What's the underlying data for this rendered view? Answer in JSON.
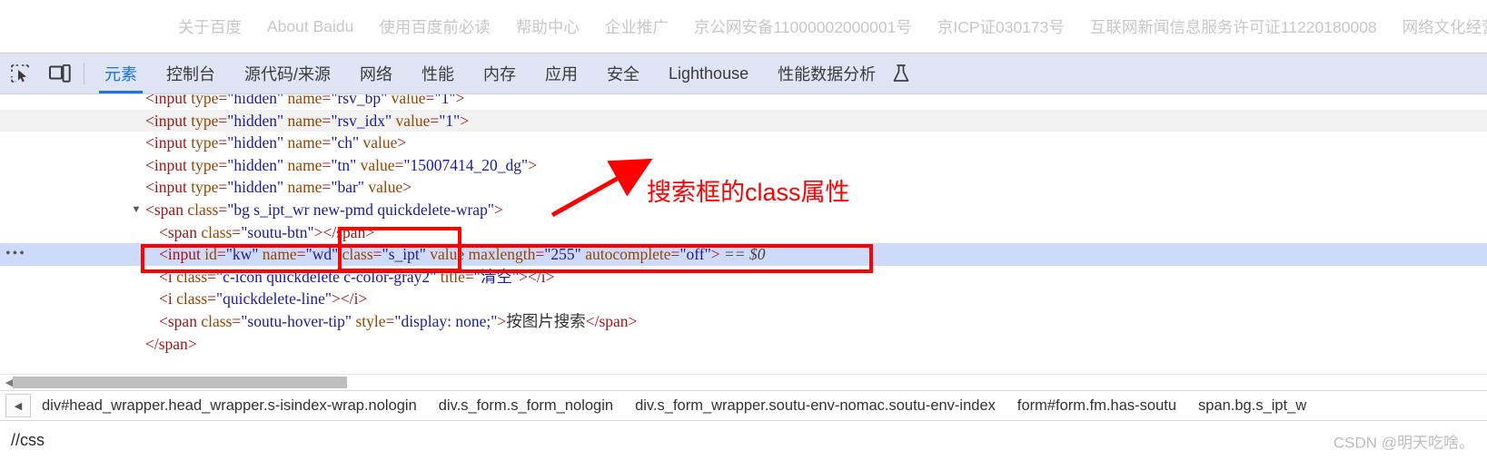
{
  "page_footer": {
    "links": [
      "关于百度",
      "About Baidu",
      "使用百度前必读",
      "帮助中心",
      "企业推广",
      "京公网安备11000002000001号",
      "京ICP证030173号",
      "互联网新闻信息服务许可证11220180008",
      "网络文化经营许"
    ]
  },
  "toolbar": {
    "inspect_icon": "inspect-element-icon",
    "device_icon": "device-toolbar-icon",
    "flask_icon": "experiments-flask-icon",
    "tabs": [
      {
        "label": "元素",
        "active": true
      },
      {
        "label": "控制台",
        "active": false
      },
      {
        "label": "源代码/来源",
        "active": false
      },
      {
        "label": "网络",
        "active": false
      },
      {
        "label": "性能",
        "active": false
      },
      {
        "label": "内存",
        "active": false
      },
      {
        "label": "应用",
        "active": false
      },
      {
        "label": "安全",
        "active": false
      },
      {
        "label": "Lighthouse",
        "active": false
      },
      {
        "label": "性能数据分析",
        "active": false
      }
    ]
  },
  "dom_tree": {
    "rows": [
      {
        "indent": 160,
        "state": "clipped",
        "twisty": "",
        "dots": false,
        "parts": [
          {
            "t": "punct",
            "s": "<"
          },
          {
            "t": "tagname",
            "s": "input"
          },
          {
            "t": "attr",
            "s": " type"
          },
          {
            "t": "punct",
            "s": "="
          },
          {
            "t": "val",
            "s": "\"hidden\""
          },
          {
            "t": "attr",
            "s": " name"
          },
          {
            "t": "punct",
            "s": "="
          },
          {
            "t": "val",
            "s": "\"rsv_bp\""
          },
          {
            "t": "attr",
            "s": " value"
          },
          {
            "t": "punct",
            "s": "="
          },
          {
            "t": "val",
            "s": "\"1\""
          },
          {
            "t": "punct",
            "s": ">"
          }
        ]
      },
      {
        "indent": 160,
        "state": "hover",
        "twisty": "",
        "dots": false,
        "parts": [
          {
            "t": "punct",
            "s": "<"
          },
          {
            "t": "tagname",
            "s": "input"
          },
          {
            "t": "attr",
            "s": " type"
          },
          {
            "t": "punct",
            "s": "="
          },
          {
            "t": "val",
            "s": "\"hidden\""
          },
          {
            "t": "attr",
            "s": " name"
          },
          {
            "t": "punct",
            "s": "="
          },
          {
            "t": "val",
            "s": "\"rsv_idx\""
          },
          {
            "t": "attr",
            "s": " value"
          },
          {
            "t": "punct",
            "s": "="
          },
          {
            "t": "val",
            "s": "\"1\""
          },
          {
            "t": "punct",
            "s": ">"
          }
        ]
      },
      {
        "indent": 160,
        "state": "",
        "twisty": "",
        "dots": false,
        "parts": [
          {
            "t": "punct",
            "s": "<"
          },
          {
            "t": "tagname",
            "s": "input"
          },
          {
            "t": "attr",
            "s": " type"
          },
          {
            "t": "punct",
            "s": "="
          },
          {
            "t": "val",
            "s": "\"hidden\""
          },
          {
            "t": "attr",
            "s": " name"
          },
          {
            "t": "punct",
            "s": "="
          },
          {
            "t": "val",
            "s": "\"ch\""
          },
          {
            "t": "attr",
            "s": " value"
          },
          {
            "t": "punct",
            "s": ">"
          }
        ]
      },
      {
        "indent": 160,
        "state": "",
        "twisty": "",
        "dots": false,
        "parts": [
          {
            "t": "punct",
            "s": "<"
          },
          {
            "t": "tagname",
            "s": "input"
          },
          {
            "t": "attr",
            "s": " type"
          },
          {
            "t": "punct",
            "s": "="
          },
          {
            "t": "val",
            "s": "\"hidden\""
          },
          {
            "t": "attr",
            "s": " name"
          },
          {
            "t": "punct",
            "s": "="
          },
          {
            "t": "val",
            "s": "\"tn\""
          },
          {
            "t": "attr",
            "s": " value"
          },
          {
            "t": "punct",
            "s": "="
          },
          {
            "t": "val",
            "s": "\"15007414_20_dg\""
          },
          {
            "t": "punct",
            "s": ">"
          }
        ]
      },
      {
        "indent": 160,
        "state": "",
        "twisty": "",
        "dots": false,
        "parts": [
          {
            "t": "punct",
            "s": "<"
          },
          {
            "t": "tagname",
            "s": "input"
          },
          {
            "t": "attr",
            "s": " type"
          },
          {
            "t": "punct",
            "s": "="
          },
          {
            "t": "val",
            "s": "\"hidden\""
          },
          {
            "t": "attr",
            "s": " name"
          },
          {
            "t": "punct",
            "s": "="
          },
          {
            "t": "val",
            "s": "\"bar\""
          },
          {
            "t": "attr",
            "s": " value"
          },
          {
            "t": "punct",
            "s": ">"
          }
        ]
      },
      {
        "indent": 160,
        "state": "",
        "twisty": "▼",
        "dots": false,
        "parts": [
          {
            "t": "punct",
            "s": "<"
          },
          {
            "t": "tagname",
            "s": "span"
          },
          {
            "t": "attr",
            "s": " class"
          },
          {
            "t": "punct",
            "s": "="
          },
          {
            "t": "val",
            "s": "\"bg s_ipt_wr new-pmd quickdelete-wrap\""
          },
          {
            "t": "punct",
            "s": ">"
          }
        ]
      },
      {
        "indent": 175,
        "state": "",
        "twisty": "",
        "dots": false,
        "parts": [
          {
            "t": "punct",
            "s": "<"
          },
          {
            "t": "tagname",
            "s": "span"
          },
          {
            "t": "attr",
            "s": " class"
          },
          {
            "t": "punct",
            "s": "="
          },
          {
            "t": "val",
            "s": "\"soutu-btn\""
          },
          {
            "t": "punct",
            "s": "></"
          },
          {
            "t": "tagname",
            "s": "span"
          },
          {
            "t": "punct",
            "s": ">"
          }
        ]
      },
      {
        "indent": 175,
        "state": "selected",
        "twisty": "",
        "dots": true,
        "parts": [
          {
            "t": "punct",
            "s": "<"
          },
          {
            "t": "tagname",
            "s": "input"
          },
          {
            "t": "attr",
            "s": " id"
          },
          {
            "t": "punct",
            "s": "="
          },
          {
            "t": "val",
            "s": "\"kw\""
          },
          {
            "t": "attr",
            "s": " name"
          },
          {
            "t": "punct",
            "s": "="
          },
          {
            "t": "val",
            "s": "\"wd\""
          },
          {
            "t": "attr",
            "s": " class"
          },
          {
            "t": "punct",
            "s": "="
          },
          {
            "t": "val",
            "s": "\"s_ipt\""
          },
          {
            "t": "attr",
            "s": " value"
          },
          {
            "t": "attr",
            "s": " maxlength"
          },
          {
            "t": "punct",
            "s": "="
          },
          {
            "t": "val",
            "s": "\"255\""
          },
          {
            "t": "attr",
            "s": " autocomplete"
          },
          {
            "t": "punct",
            "s": "="
          },
          {
            "t": "val",
            "s": "\"off\""
          },
          {
            "t": "punct",
            "s": ">"
          },
          {
            "t": "dollar",
            "s": "  == $0"
          }
        ]
      },
      {
        "indent": 175,
        "state": "",
        "twisty": "",
        "dots": false,
        "parts": [
          {
            "t": "punct",
            "s": "<"
          },
          {
            "t": "tagname",
            "s": "i"
          },
          {
            "t": "attr",
            "s": " class"
          },
          {
            "t": "punct",
            "s": "="
          },
          {
            "t": "val",
            "s": "\"c-icon quickdelete c-color-gray2\""
          },
          {
            "t": "attr",
            "s": " title"
          },
          {
            "t": "punct",
            "s": "="
          },
          {
            "t": "val",
            "s": "\"清空\""
          },
          {
            "t": "punct",
            "s": "></"
          },
          {
            "t": "tagname",
            "s": "i"
          },
          {
            "t": "punct",
            "s": ">"
          }
        ]
      },
      {
        "indent": 175,
        "state": "",
        "twisty": "",
        "dots": false,
        "parts": [
          {
            "t": "punct",
            "s": "<"
          },
          {
            "t": "tagname",
            "s": "i"
          },
          {
            "t": "attr",
            "s": " class"
          },
          {
            "t": "punct",
            "s": "="
          },
          {
            "t": "val",
            "s": "\"quickdelete-line\""
          },
          {
            "t": "punct",
            "s": "></"
          },
          {
            "t": "tagname",
            "s": "i"
          },
          {
            "t": "punct",
            "s": ">"
          }
        ]
      },
      {
        "indent": 175,
        "state": "",
        "twisty": "",
        "dots": false,
        "parts": [
          {
            "t": "punct",
            "s": "<"
          },
          {
            "t": "tagname",
            "s": "span"
          },
          {
            "t": "attr",
            "s": " class"
          },
          {
            "t": "punct",
            "s": "="
          },
          {
            "t": "val",
            "s": "\"soutu-hover-tip\""
          },
          {
            "t": "attr",
            "s": " style"
          },
          {
            "t": "punct",
            "s": "="
          },
          {
            "t": "val",
            "s": "\"display: none;\""
          },
          {
            "t": "punct",
            "s": ">"
          },
          {
            "t": "txtnode",
            "s": "按图片搜索"
          },
          {
            "t": "punct",
            "s": "</"
          },
          {
            "t": "tagname",
            "s": "span"
          },
          {
            "t": "punct",
            "s": ">"
          }
        ]
      },
      {
        "indent": 160,
        "state": "",
        "twisty": "",
        "dots": false,
        "parts": [
          {
            "t": "punct",
            "s": "</"
          },
          {
            "t": "tagname",
            "s": "span"
          },
          {
            "t": "punct",
            "s": ">"
          }
        ]
      }
    ]
  },
  "breadcrumb": {
    "back_arrow": "◀",
    "items": [
      "div#head_wrapper.head_wrapper.s-isindex-wrap.nologin",
      "div.s_form.s_form_nologin",
      "div.s_form_wrapper.soutu-env-nomac.soutu-env-index",
      "form#form.fm.has-soutu",
      "span.bg.s_ipt_w"
    ]
  },
  "bottom": {
    "text": "//css",
    "watermark": "CSDN @明天吃啥。"
  },
  "annotations": {
    "note": "搜索框的class属性",
    "arrow": "red-arrow-icon",
    "color": "#ff0000"
  },
  "scrollbar": {
    "left_arrow": "◀"
  }
}
